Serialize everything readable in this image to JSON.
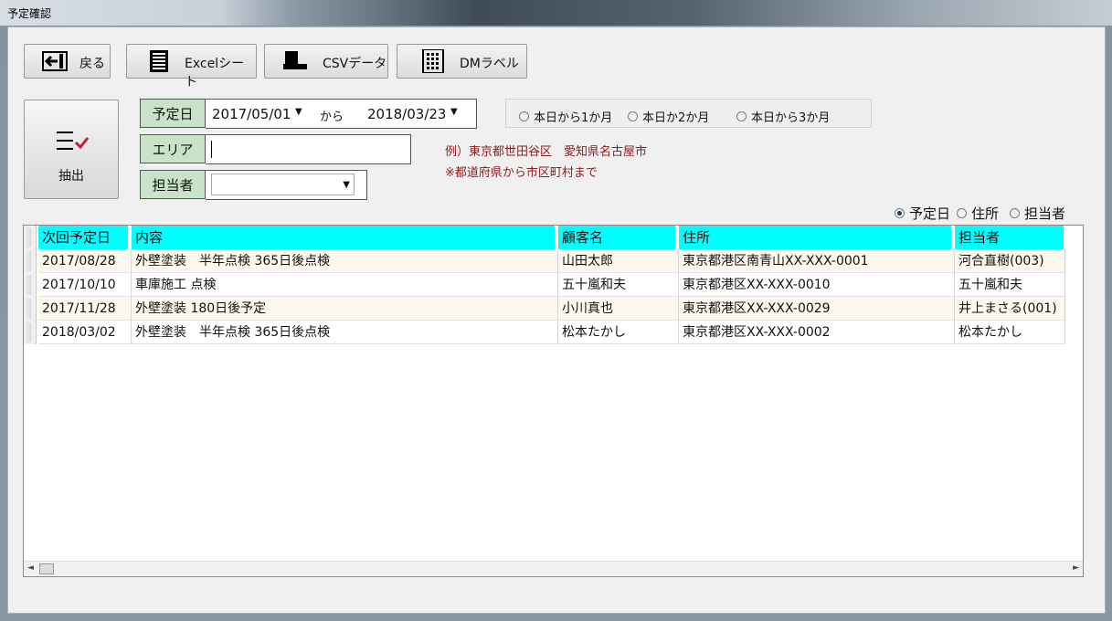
{
  "window": {
    "title": "予定確認"
  },
  "toolbar": {
    "back_label": "戻る",
    "excel_label": "Excelシート",
    "csv_label": "CSVデータ",
    "dm_label": "DMラベル"
  },
  "extract": {
    "label": "抽出"
  },
  "filters": {
    "date_label": "予定日",
    "date_from": "2017/05/01",
    "date_sep": "から",
    "date_to": "2018/03/23",
    "area_label": "エリア",
    "area_value": "",
    "tanto_label": "担当者",
    "tanto_value": "",
    "example_line1": "例）東京都世田谷区　愛知県名古屋市",
    "example_line2": "※都道府県から市区町村まで"
  },
  "period": {
    "options": [
      "本日から1か月",
      "本日か2か月",
      "本日から3か月"
    ]
  },
  "sort": {
    "options": [
      "予定日",
      "住所",
      "担当者"
    ],
    "selected": "予定日"
  },
  "grid": {
    "columns": [
      "次回予定日",
      "内容",
      "顧客名",
      "住所",
      "担当者"
    ],
    "rows": [
      [
        "2017/08/28",
        "外壁塗装　半年点検 365日後点検",
        "山田太郎",
        "東京都港区南青山XX-XXX-0001",
        "河合直樹(003)"
      ],
      [
        "2017/10/10",
        "車庫施工 点検",
        "五十嵐和夫",
        "東京都港区XX-XXX-0010",
        "五十嵐和夫"
      ],
      [
        "2017/11/28",
        "外壁塗装 180日後予定",
        "小川真也",
        "東京都港区XX-XXX-0029",
        "井上まさる(001)"
      ],
      [
        "2018/03/02",
        "外壁塗装　半年点検 365日後点検",
        "松本たかし",
        "東京都港区XX-XXX-0002",
        "松本たかし"
      ]
    ]
  },
  "colors": {
    "header_cyan": "#00ffff",
    "label_green": "#c9e3c9",
    "example_red": "#8b1a1a",
    "alt_row": "#fdf8ee"
  }
}
